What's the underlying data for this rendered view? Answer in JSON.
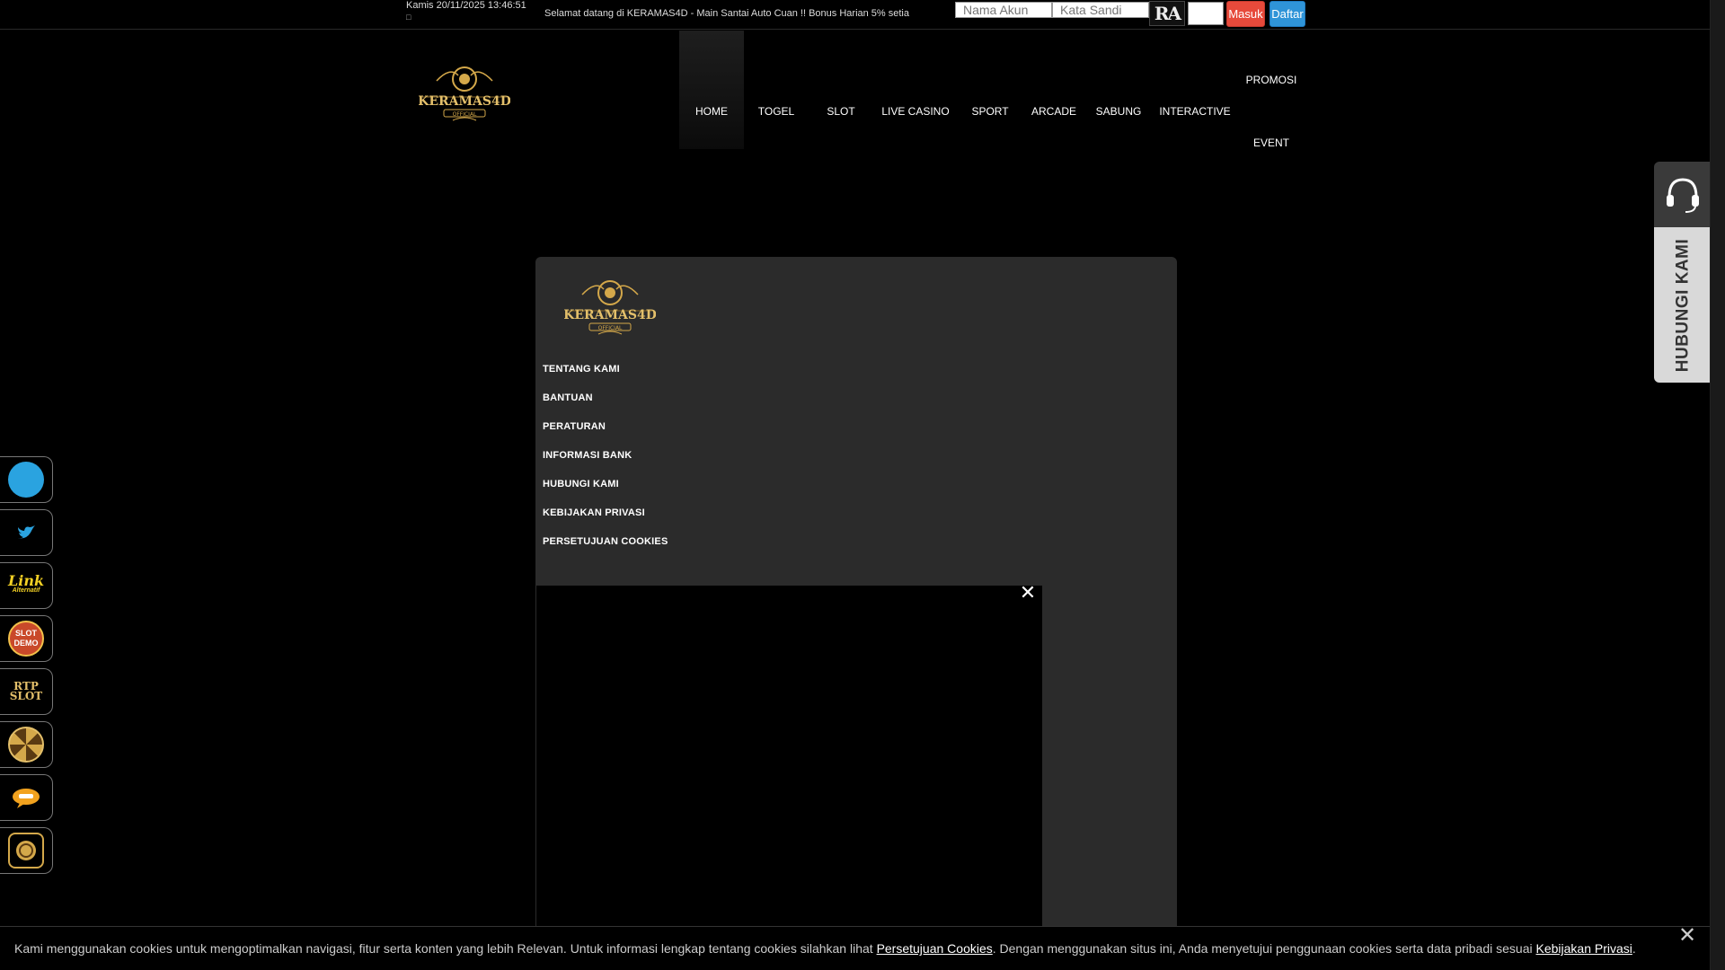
{
  "topbar": {
    "datetime": "Kamis 20/11/2025 13:46:51",
    "marquee": "Selamat datang di KERAMAS4D - Main Santai Auto Cuan !! Bonus Harian 5% setia",
    "username_placeholder": "Nama Akun",
    "password_placeholder": "Kata Sandi",
    "captcha_text": "RA",
    "login_label": "Masuk",
    "register_label": "Daftar"
  },
  "brand": {
    "name": "KERAMAS4D",
    "sub": "OFFICIAL"
  },
  "nav": {
    "home": "HOME",
    "togel": "TOGEL",
    "slot": "SLOT",
    "live_casino": "LIVE CASINO",
    "sport": "SPORT",
    "arcade": "ARCADE",
    "sabung": "SABUNG",
    "interactive": "INTERACTIVE",
    "promosi": "PROMOSI",
    "event": "EVENT"
  },
  "footer_links": [
    "TENTANG KAMI",
    "BANTUAN",
    "PERATURAN",
    "INFORMASI BANK",
    "HUBUNGI KAMI",
    "KEBIJAKAN PRIVASI",
    "PERSETUJUAN COOKIES"
  ],
  "sidebar": {
    "link_label": "Link",
    "link_sub": "Alternatif",
    "slot_demo": "SLOT DEMO",
    "rtp_slot": "RTP SLOT"
  },
  "contact": {
    "label": "HUBUNGI KAMI"
  },
  "cookie": {
    "text_before": "Kami menggunakan cookies untuk mengoptimalkan navigasi, fitur serta konten yang lebih Relevan. Untuk informasi lengkap tentang cookies silahkan lihat ",
    "consent_link": "Persetujuan Cookies",
    "text_middle": ". Dengan menggunakan situs ini, Anda menyetujui penggunaan cookies serta data pribadi sesuai ",
    "privacy_link": "Kebijakan Privasi",
    "text_end": "."
  },
  "colors": {
    "login_button": "#e74a3b",
    "register_button": "#2f94d8",
    "logo_gold": "#d4a84a",
    "panel_bg": "#2b2b2b",
    "telegram": "#2aa3e0"
  }
}
